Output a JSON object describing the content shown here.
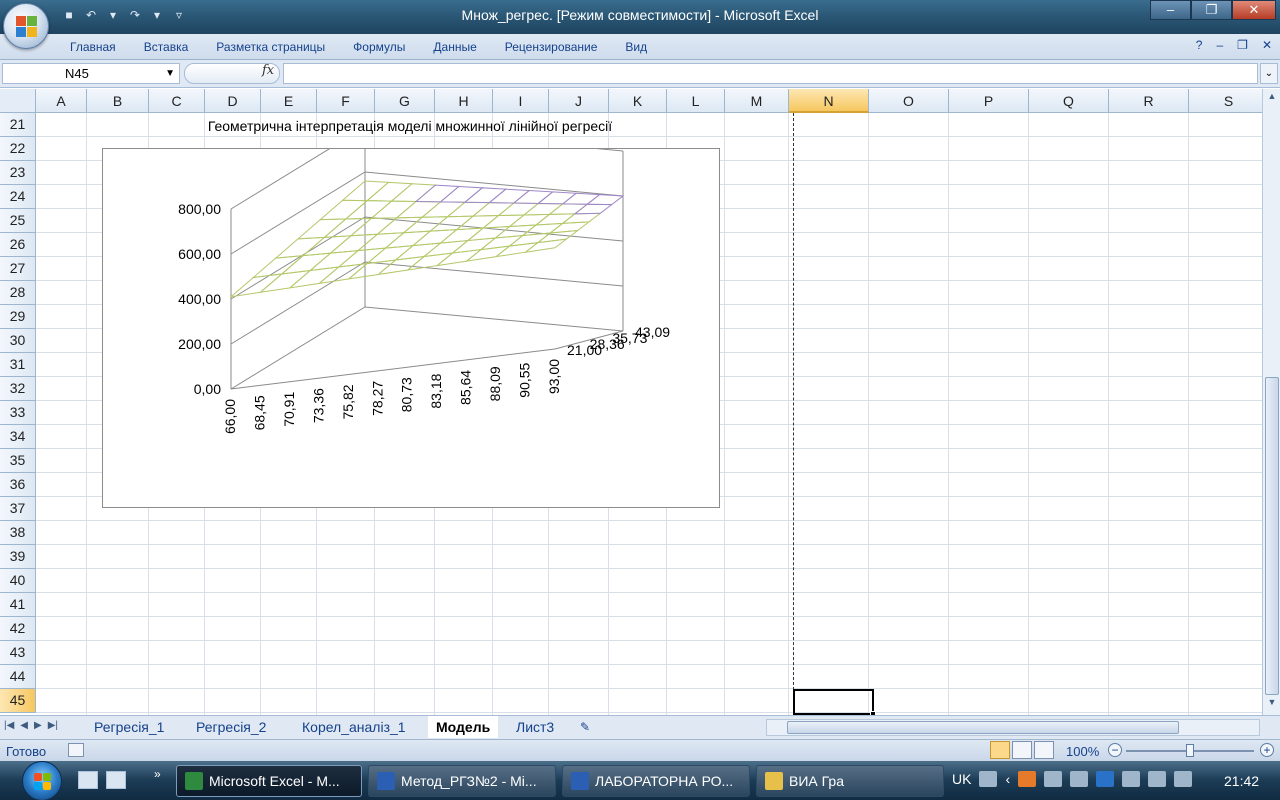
{
  "window": {
    "title": "Множ_регрес.  [Режим совместимости] - Microsoft Excel",
    "min": "–",
    "max": "❐",
    "close": "✕"
  },
  "ribbon": {
    "tabs": [
      "Главная",
      "Вставка",
      "Разметка страницы",
      "Формулы",
      "Данные",
      "Рецензирование",
      "Вид"
    ],
    "help": "?",
    "min": "–",
    "restore": "❐",
    "close": "✕"
  },
  "formula_bar": {
    "name_box": "N45",
    "fx": "fx",
    "formula": ""
  },
  "columns": [
    "A",
    "B",
    "C",
    "D",
    "E",
    "F",
    "G",
    "H",
    "I",
    "J",
    "K",
    "L",
    "M",
    "N",
    "O",
    "P",
    "Q",
    "R",
    "S"
  ],
  "active_column": "N",
  "rows": [
    "21",
    "22",
    "23",
    "24",
    "25",
    "26",
    "27",
    "28",
    "29",
    "30",
    "31",
    "32",
    "33",
    "34",
    "35",
    "36",
    "37",
    "38",
    "39",
    "40",
    "41",
    "42",
    "43",
    "44",
    "45"
  ],
  "active_row": "45",
  "sheet_title": "Геометрична інтерпретація моделі множинної лінійної регресії",
  "chart_data": {
    "type": "surface",
    "title": "",
    "z_ticks": [
      "800,00",
      "600,00",
      "400,00",
      "200,00",
      "0,00"
    ],
    "zlim": [
      0,
      800
    ],
    "x_ticks": [
      "66,00",
      "68,45",
      "70,91",
      "73,36",
      "75,82",
      "78,27",
      "80,73",
      "83,18",
      "85,64",
      "88,09",
      "90,55",
      "93,00"
    ],
    "y_ticks": [
      "21,00",
      "28,36",
      "35,73",
      "43,09"
    ],
    "bands": [
      {
        "range": "400-600",
        "color": "#b4c86a"
      },
      {
        "range": "600-800",
        "color": "#9e86c8"
      }
    ]
  },
  "sheet_tabs": [
    "Регресія_1",
    "Регресія_2",
    "Корел_аналіз_1",
    "Модель",
    "Лист3"
  ],
  "active_sheet": "Модель",
  "status": {
    "ready": "Готово",
    "zoom": "100%",
    "minus": "−",
    "plus": "+"
  },
  "taskbar": {
    "tasks": [
      "Microsoft Excel - M...",
      "Метод_РГЗ№2 - Mi...",
      "ЛАБОРАТОРНА РО...",
      "ВИА Гра"
    ],
    "lang": "UK",
    "time": "21:42"
  }
}
